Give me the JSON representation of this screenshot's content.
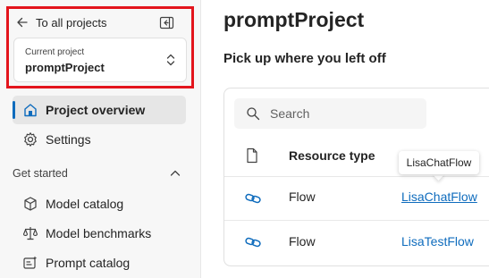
{
  "sidebar": {
    "back_label": "To all projects",
    "project_caption": "Current project",
    "project_name": "promptProject",
    "items": [
      {
        "label": "Project overview",
        "icon": "home-icon",
        "active": true
      },
      {
        "label": "Settings",
        "icon": "gear-icon",
        "active": false
      }
    ],
    "section_label": "Get started",
    "section_items": [
      {
        "label": "Model catalog",
        "icon": "cube-icon"
      },
      {
        "label": "Model benchmarks",
        "icon": "scale-icon"
      },
      {
        "label": "Prompt catalog",
        "icon": "prompt-sparkle-icon"
      }
    ]
  },
  "main": {
    "title": "promptProject",
    "subtitle": "Pick up where you left off",
    "search_placeholder": "Search",
    "table": {
      "columns": [
        "Resource type"
      ],
      "rows": [
        {
          "type": "Flow",
          "name": "LisaChatFlow",
          "icon": "flow-link-icon"
        },
        {
          "type": "Flow",
          "name": "LisaTestFlow",
          "icon": "flow-link-icon"
        }
      ]
    },
    "tooltip": "LisaChatFlow"
  },
  "colors": {
    "accent": "#0f6cbd",
    "highlight_border": "#e3141c",
    "sidebar_bg": "#f7f7f7"
  }
}
